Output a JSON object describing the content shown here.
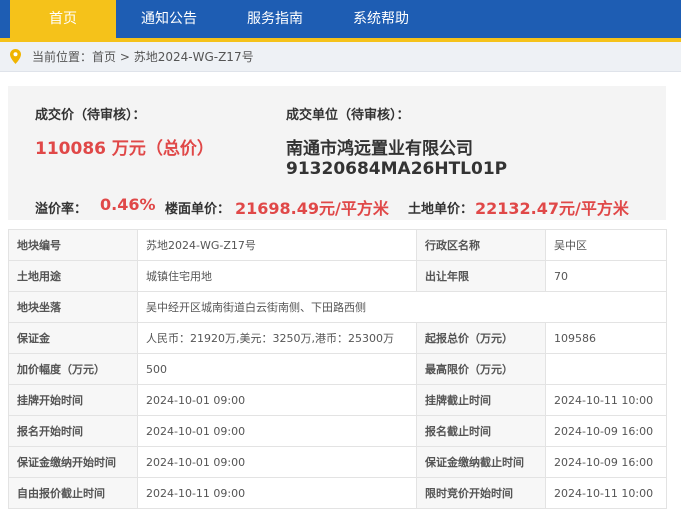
{
  "nav": {
    "items": [
      "首页",
      "通知公告",
      "服务指南",
      "系统帮助"
    ]
  },
  "breadcrumb": {
    "prefix": "当前位置：",
    "home": "首页",
    "sep": " > ",
    "current": "苏地2024-WG-Z17号"
  },
  "result": {
    "price_label": "成交价（待审核）：",
    "price_value": "110086 万元（总价）",
    "winner_label": "成交单位（待审核）：",
    "winner_name": "南通市鸿远置业有限公司",
    "winner_code": "91320684MA26HTL01P",
    "premium_label": "溢价率：",
    "premium_value": "0.46%",
    "floor_price_label": "楼面单价：",
    "floor_price_value": "21698.49元/平方米",
    "land_price_label": "土地单价：",
    "land_price_value": "22132.47元/平方米"
  },
  "table": {
    "rows": [
      {
        "k1": "地块编号",
        "v1": "苏地2024-WG-Z17号",
        "k2": "行政区名称",
        "v2": "吴中区"
      },
      {
        "k1": "土地用途",
        "v1": "城镇住宅用地",
        "k2": "出让年限",
        "v2": "70"
      },
      {
        "k1": "地块坐落",
        "v1": "吴中经开区城南街道白云街南侧、下田路西侧"
      },
      {
        "k1": "保证金",
        "v1": "人民币：21920万,美元：3250万,港币：25300万",
        "k2": "起报总价（万元）",
        "v2": "109586"
      },
      {
        "k1": "加价幅度（万元）",
        "v1": "500",
        "k2": "最高限价（万元）",
        "v2": ""
      },
      {
        "k1": "挂牌开始时间",
        "v1": "2024-10-01 09:00",
        "k2": "挂牌截止时间",
        "v2": "2024-10-11 10:00"
      },
      {
        "k1": "报名开始时间",
        "v1": "2024-10-01 09:00",
        "k2": "报名截止时间",
        "v2": "2024-10-09 16:00"
      },
      {
        "k1": "保证金缴纳开始时间",
        "v1": "2024-10-01 09:00",
        "k2": "保证金缴纳截止时间",
        "v2": "2024-10-09 16:00"
      },
      {
        "k1": "自由报价截止时间",
        "v1": "2024-10-11 09:00",
        "k2": "限时竞价开始时间",
        "v2": "2024-10-11 10:00"
      }
    ]
  },
  "colors": {
    "nav_bg": "#1e5db3",
    "nav_active": "#f5c21a",
    "accent_red": "#e04848"
  }
}
